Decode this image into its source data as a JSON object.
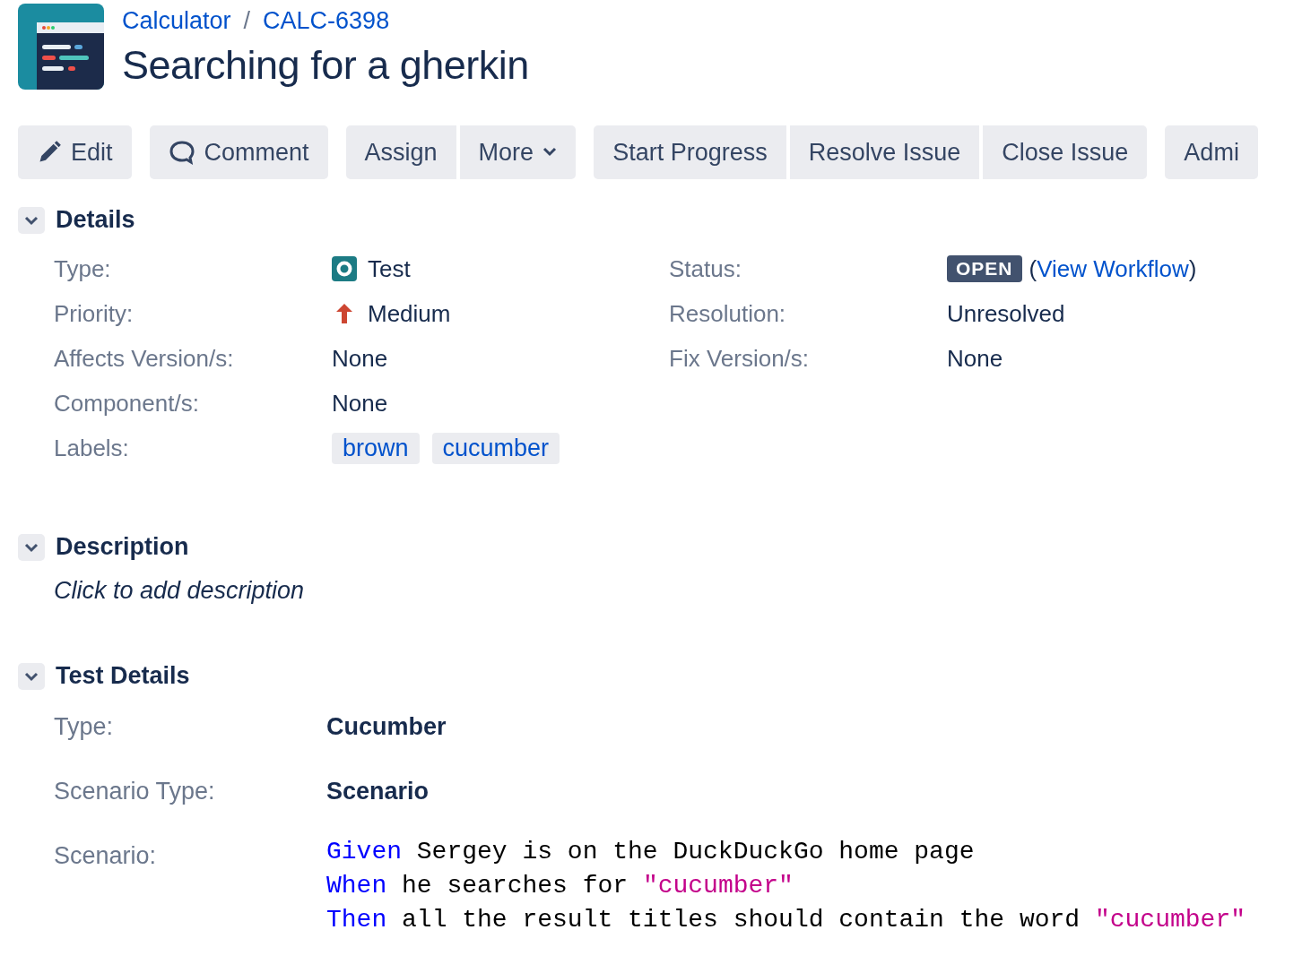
{
  "breadcrumb": [
    {
      "text": "Calculator"
    },
    {
      "text": "CALC-6398"
    }
  ],
  "breadcrumb_separator": "/",
  "title": "Searching for a gherkin",
  "toolbar": [
    {
      "buttons": [
        {
          "label": "Edit",
          "kind": "pencil"
        }
      ]
    },
    {
      "buttons": [
        {
          "label": "Comment",
          "kind": "comment"
        }
      ]
    },
    {
      "buttons": [
        {
          "label": "Assign",
          "kind": "plain"
        },
        {
          "label": "More",
          "kind": "dropdown"
        }
      ]
    },
    {
      "buttons": [
        {
          "label": "Start Progress",
          "kind": "plain"
        },
        {
          "label": "Resolve Issue",
          "kind": "plain"
        },
        {
          "label": "Close Issue",
          "kind": "plain"
        }
      ]
    },
    {
      "buttons": [
        {
          "label": "Admi",
          "kind": "plain"
        }
      ]
    }
  ],
  "details": {
    "heading": "Details",
    "expanded": true,
    "left": [
      {
        "label": "Type:",
        "value": "Test",
        "kind": "type"
      },
      {
        "label": "Priority:",
        "value": "Medium",
        "kind": "priority"
      },
      {
        "label": "Affects Version/s:",
        "value": "None",
        "kind": "text"
      },
      {
        "label": "Component/s:",
        "value": "None",
        "kind": "text"
      },
      {
        "label": "Labels:",
        "kind": "labels",
        "labels": [
          "brown",
          "cucumber"
        ]
      }
    ],
    "right": [
      {
        "label": "Status:",
        "kind": "status",
        "lozenge": "OPEN",
        "link_open": "(",
        "link": "View Workflow",
        "link_close": ")"
      },
      {
        "label": "Resolution:",
        "value": "Unresolved",
        "kind": "text"
      },
      {
        "label": "Fix Version/s:",
        "value": "None",
        "kind": "text"
      }
    ]
  },
  "description": {
    "heading": "Description",
    "expanded": true,
    "empty_text": "Click to add description"
  },
  "test_details": {
    "heading": "Test Details",
    "expanded": true,
    "fields": [
      {
        "label": "Type:",
        "value": "Cucumber"
      },
      {
        "label": "Scenario Type:",
        "value": "Scenario"
      }
    ],
    "scenario": {
      "label": "Scenario:",
      "lines": [
        [
          {
            "kind": "keyword",
            "text": "Given"
          },
          {
            "kind": "text",
            "text": " Sergey is on the DuckDuckGo home page"
          }
        ],
        [
          {
            "kind": "keyword",
            "text": "When"
          },
          {
            "kind": "text",
            "text": " he searches for "
          },
          {
            "kind": "string",
            "text": "\"cucumber\""
          }
        ],
        [
          {
            "kind": "keyword",
            "text": "Then"
          },
          {
            "kind": "text",
            "text": " all the result titles should contain the word "
          },
          {
            "kind": "string",
            "text": "\"cucumber\""
          }
        ]
      ]
    }
  }
}
